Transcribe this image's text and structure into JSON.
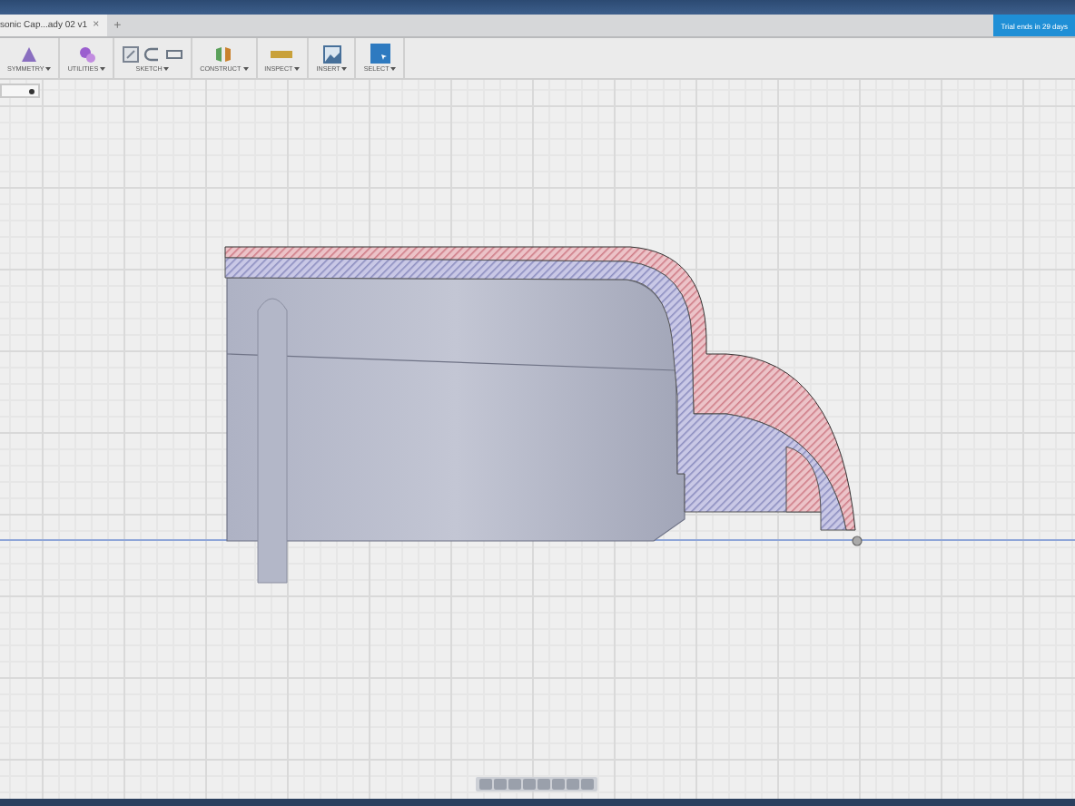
{
  "tab": {
    "title": "sonic Cap...ady 02 v1",
    "close": "×",
    "new_tab": "+"
  },
  "trial_banner": "Trial ends in 29 days",
  "toolbar": [
    {
      "label": "SYMMETRY"
    },
    {
      "label": "UTILITIES"
    },
    {
      "label": "SKETCH"
    },
    {
      "label": "CONSTRUCT"
    },
    {
      "label": "INSPECT"
    },
    {
      "label": "INSERT"
    },
    {
      "label": "SELECT"
    }
  ]
}
